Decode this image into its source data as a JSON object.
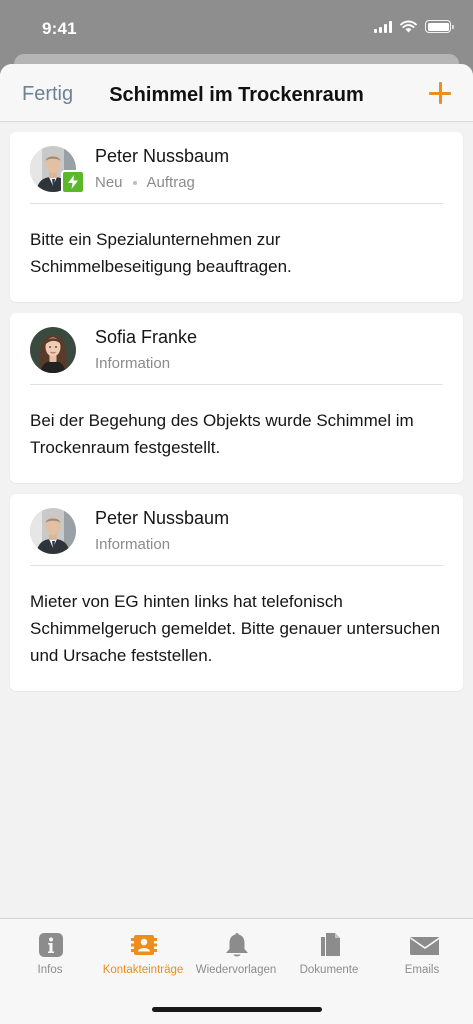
{
  "status_bar": {
    "time": "9:41"
  },
  "nav": {
    "done_label": "Fertig",
    "title": "Schimmel im Trockenraum",
    "add_icon": "plus-icon",
    "accent_color": "#ec8d1f"
  },
  "entries": [
    {
      "author": "Peter Nussbaum",
      "status": "Neu",
      "type": "Auftrag",
      "badge_icon": "lightning-icon",
      "text": "Bitte ein Spezialunternehmen zur Schimmelbeseitigung beauftragen."
    },
    {
      "author": "Sofia Franke",
      "type": "Information",
      "text": "Bei der Begehung des Objekts wurde Schimmel im Trockenraum festgestellt."
    },
    {
      "author": "Peter Nussbaum",
      "type": "Information",
      "text": "Mieter von EG hinten links hat telefonisch Schimmelgeruch gemeldet. Bitte genauer untersuchen und Ursache feststellen."
    }
  ],
  "tabs": [
    {
      "label": "Infos",
      "icon": "info-icon"
    },
    {
      "label": "Kontakteinträge",
      "icon": "contacts-icon",
      "active": true
    },
    {
      "label": "Wiedervorlagen",
      "icon": "bell-icon"
    },
    {
      "label": "Dokumente",
      "icon": "documents-icon"
    },
    {
      "label": "Emails",
      "icon": "envelope-icon"
    }
  ]
}
